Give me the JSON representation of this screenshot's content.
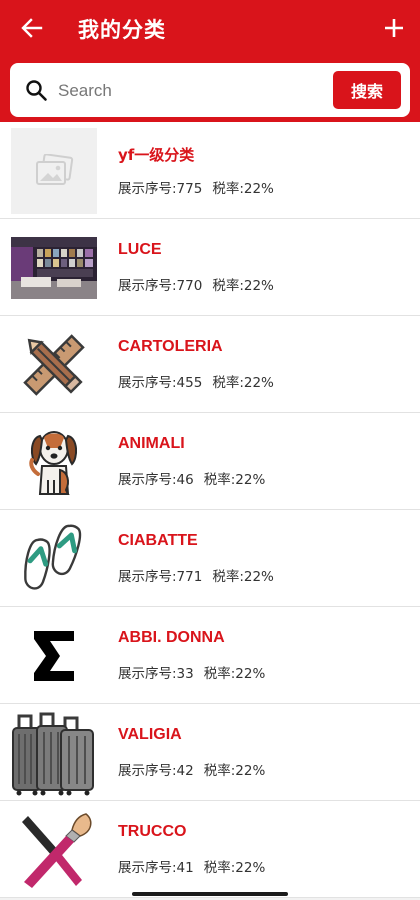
{
  "header": {
    "title": "我的分类",
    "background": "#d9141b",
    "back_icon": "arrow-left-icon",
    "add_icon": "plus-icon"
  },
  "search": {
    "placeholder": "Search",
    "button_label": "搜索"
  },
  "categories": [
    {
      "name": "yf一级分类",
      "order_label": "展示序号:775",
      "tax_label": "税率:22%",
      "icon": "placeholder-image-icon"
    },
    {
      "name": "LUCE",
      "order_label": "展示序号:770",
      "tax_label": "税率:22%",
      "icon": "store-photo"
    },
    {
      "name": "CARTOLERIA",
      "order_label": "展示序号:455",
      "tax_label": "税率:22%",
      "icon": "pencil-ruler-icon"
    },
    {
      "name": "ANIMALI",
      "order_label": "展示序号:46",
      "tax_label": "税率:22%",
      "icon": "dog-icon"
    },
    {
      "name": "CIABATTE",
      "order_label": "展示序号:771",
      "tax_label": "税率:22%",
      "icon": "flip-flops-icon"
    },
    {
      "name": "ABBI. DONNA",
      "order_label": "展示序号:33",
      "tax_label": "税率:22%",
      "icon": "sigma-icon"
    },
    {
      "name": "VALIGIA",
      "order_label": "展示序号:42",
      "tax_label": "税率:22%",
      "icon": "suitcases-icon"
    },
    {
      "name": "TRUCCO",
      "order_label": "展示序号:41",
      "tax_label": "税率:22%",
      "icon": "makeup-brushes-icon"
    }
  ]
}
